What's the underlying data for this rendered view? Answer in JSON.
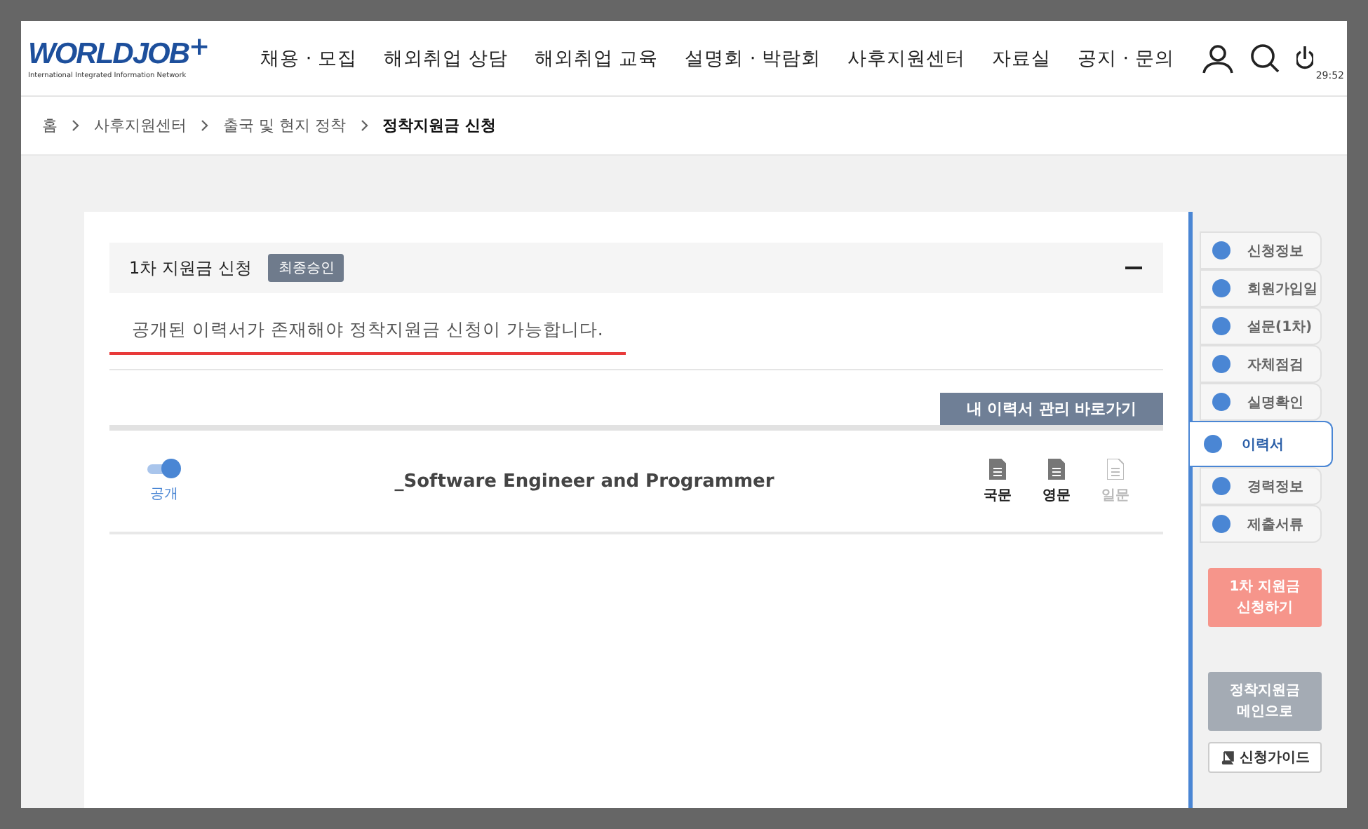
{
  "header": {
    "logo": {
      "brand": "WORLDJOB",
      "plus": "+",
      "tagline": "International Integrated Information Network"
    },
    "nav": [
      "채용 · 모집",
      "해외취업 상담",
      "해외취업 교육",
      "설명회 · 박람회",
      "사후지원센터",
      "자료실",
      "공지 · 문의"
    ],
    "timer": "29:52"
  },
  "breadcrumb": [
    {
      "label": "홈",
      "current": false
    },
    {
      "label": "사후지원센터",
      "current": false
    },
    {
      "label": "출국 및 현지 정착",
      "current": false
    },
    {
      "label": "정착지원금 신청",
      "current": true
    }
  ],
  "section": {
    "title": "1차 지원금 신청",
    "badge": "최종승인",
    "expanded": true,
    "notice": "공개된 이력서가 존재해야 정착지원금 신청이 가능합니다.",
    "resume_button": "내 이력서 관리 바로가기",
    "resume": {
      "public": true,
      "public_label": "공개",
      "title": "_Software Engineer and Programmer",
      "docs": [
        {
          "label": "국문",
          "available": true
        },
        {
          "label": "영문",
          "available": true
        },
        {
          "label": "일문",
          "available": false
        }
      ]
    }
  },
  "side_tabs": [
    {
      "label": "신청정보",
      "selected": false
    },
    {
      "label": "회원가입일",
      "selected": false
    },
    {
      "label": "설문(1차)",
      "selected": false
    },
    {
      "label": "자체점검",
      "selected": false
    },
    {
      "label": "실명확인",
      "selected": false
    },
    {
      "label": "이력서",
      "selected": true
    },
    {
      "label": "경력정보",
      "selected": false
    },
    {
      "label": "제출서류",
      "selected": false
    }
  ],
  "side_buttons": [
    {
      "kind": "apply",
      "label": "1차 지원금\n신청하기"
    },
    {
      "kind": "main",
      "label": "정착지원금\n메인으로"
    },
    {
      "kind": "guide",
      "label": "신청가이드"
    }
  ]
}
